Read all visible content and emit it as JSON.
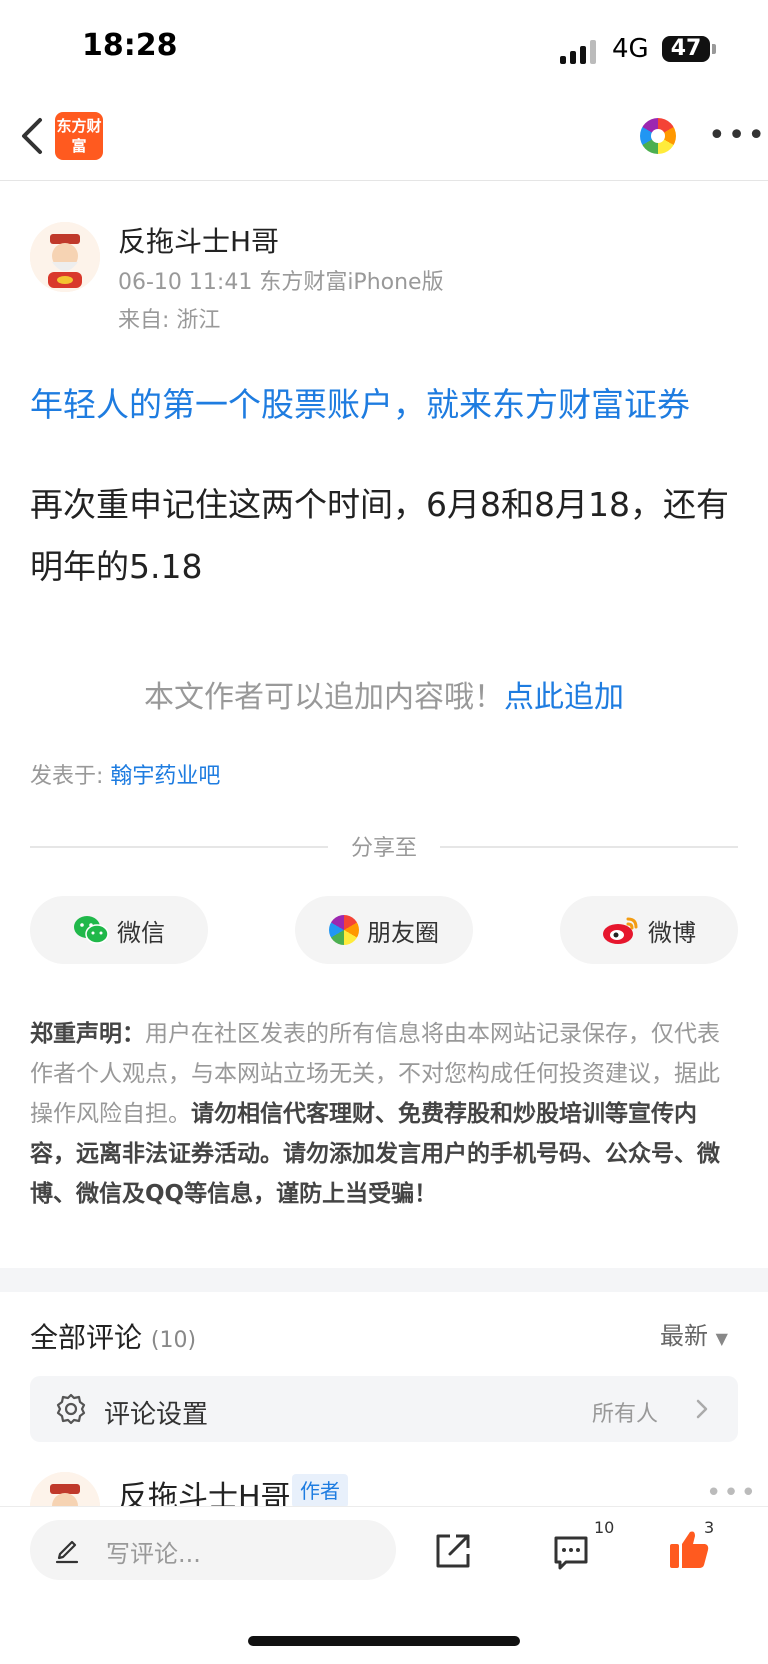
{
  "status_bar": {
    "time": "18:28",
    "network": "4G",
    "battery": "47"
  },
  "nav": {
    "logo_text": "东方财富"
  },
  "post": {
    "author": "反拖斗士H哥",
    "meta": "06-10 11:41 东方财富iPhone版",
    "location": "来自: 浙江",
    "ad": "年轻人的第一个股票账户，就来东方财富证券",
    "body": "再次重申记住这两个时间，6月8和8月18，还有明年的5.18",
    "append_hint": "本文作者可以追加内容哦！",
    "append_link": "点此追加",
    "posted_in_label": "发表于: ",
    "posted_in_bar": "翰宇药业吧"
  },
  "share": {
    "title": "分享至",
    "buttons": [
      {
        "label": "微信",
        "icon": "wechat-icon"
      },
      {
        "label": "朋友圈",
        "icon": "moments-icon"
      },
      {
        "label": "微博",
        "icon": "weibo-icon"
      }
    ]
  },
  "disclaimer": {
    "heading": "郑重声明：",
    "normal": "用户在社区发表的所有信息将由本网站记录保存，仅代表作者个人观点，与本网站立场无关，不对您构成任何投资建议，据此操作风险自担。",
    "bold": "请勿相信代客理财、免费荐股和炒股培训等宣传内容，远离非法证券活动。请勿添加发言用户的手机号码、公众号、微博、微信及QQ等信息，谨防上当受骗！"
  },
  "comments": {
    "title": "全部评论",
    "count": "(10)",
    "sort": "最新",
    "settings_label": "评论设置",
    "settings_value": "所有人",
    "first_author": "反拖斗士H哥",
    "first_badge": "作者"
  },
  "bottom_bar": {
    "input_placeholder": "写评论...",
    "comment_count": "10",
    "like_count": "3"
  },
  "colors": {
    "brand": "#ff5a1f",
    "link": "#1e7ce0",
    "like": "#ff5a1f"
  }
}
